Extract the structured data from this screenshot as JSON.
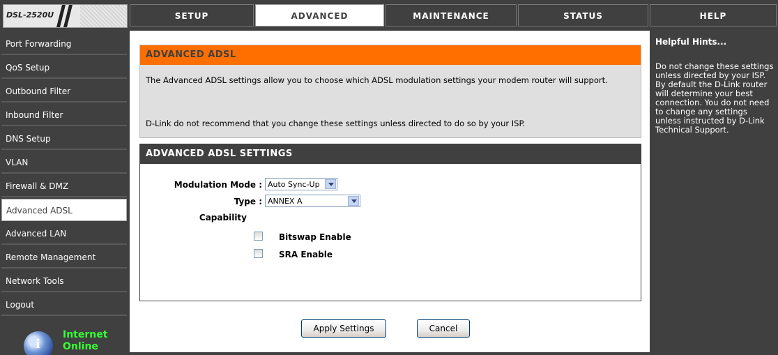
{
  "logo": {
    "text": "DSL-2520U"
  },
  "top_nav": [
    {
      "label": "SETUP"
    },
    {
      "label": "ADVANCED"
    },
    {
      "label": "MAINTENANCE"
    },
    {
      "label": "STATUS"
    },
    {
      "label": "HELP"
    }
  ],
  "sidebar": {
    "items": [
      {
        "label": "Port Forwarding"
      },
      {
        "label": "QoS Setup"
      },
      {
        "label": "Outbound Filter"
      },
      {
        "label": "Inbound Filter"
      },
      {
        "label": "DNS Setup"
      },
      {
        "label": "VLAN"
      },
      {
        "label": "Firewall & DMZ"
      },
      {
        "label": "Advanced ADSL"
      },
      {
        "label": "Advanced LAN"
      },
      {
        "label": "Remote Management"
      },
      {
        "label": "Network Tools"
      },
      {
        "label": "Logout"
      }
    ],
    "status": {
      "line1": "Internet",
      "line2": "Online"
    }
  },
  "advanced_adsl": {
    "title": "ADVANCED ADSL",
    "desc1": "The Advanced ADSL settings allow you to choose which ADSL modulation settings your modem router will support.",
    "desc2": "D-Link do not recommend that you change these settings unless directed to do so by your ISP."
  },
  "settings": {
    "title": "ADVANCED ADSL SETTINGS",
    "modulation_label": "Modulation Mode :",
    "modulation_value": "Auto Sync-Up",
    "type_label": "Type :",
    "type_value": "ANNEX A",
    "capability_label": "Capability",
    "bitswap_label": "Bitswap Enable",
    "sra_label": "SRA Enable"
  },
  "buttons": {
    "apply": "Apply Settings",
    "cancel": "Cancel"
  },
  "hints": {
    "title": "Helpful Hints...",
    "text": "Do not change these settings unless directed by your ISP. By default the D-Link router will determine your best connection. You do not need to change any settings unless instructed by D-Link Technical Support."
  },
  "colors": {
    "dark_bg": "#404040",
    "orange": "#ff6f00",
    "status_green": "#33ff33"
  }
}
